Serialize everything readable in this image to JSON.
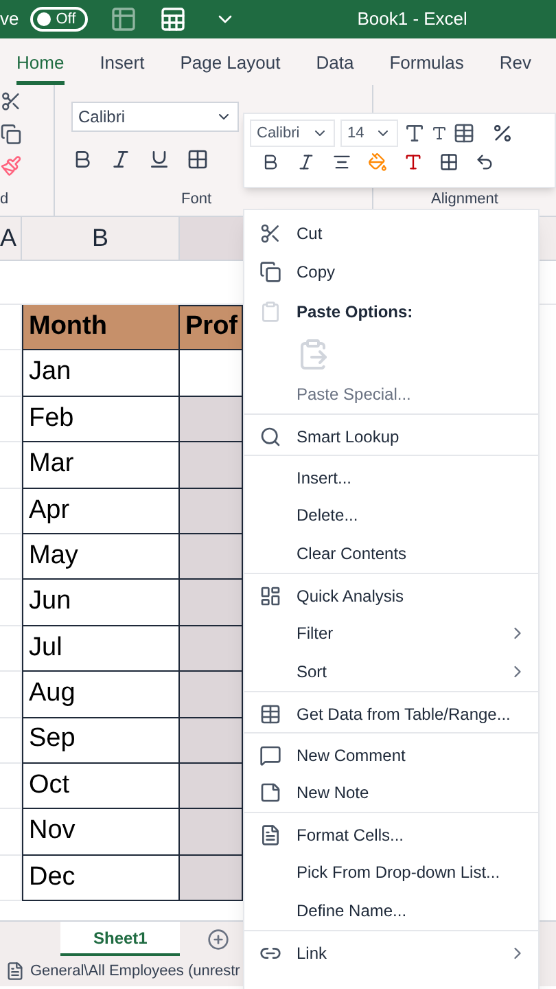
{
  "title_bar": {
    "autosave_label": "ve",
    "toggle": {
      "label": "Off",
      "on": false
    },
    "title": "Book1  -  Excel"
  },
  "ribbon_tabs": [
    {
      "label": "Home",
      "selected": true
    },
    {
      "label": "Insert",
      "selected": false
    },
    {
      "label": "Page Layout",
      "selected": false
    },
    {
      "label": "Data",
      "selected": false
    },
    {
      "label": "Formulas",
      "selected": false
    },
    {
      "label": "Rev",
      "selected": false
    }
  ],
  "ribbon": {
    "font_name": "Calibri",
    "groups": [
      "d",
      "Font",
      "Alignment"
    ]
  },
  "mini_toolbar": {
    "font_name": "Calibri",
    "font_size": "14"
  },
  "columns": [
    "A",
    "B"
  ],
  "sheet": {
    "rows": [
      {
        "kind": "header",
        "month": "Month",
        "c": "Prof"
      },
      {
        "kind": "data",
        "month": "Jan",
        "selected": false
      },
      {
        "kind": "data",
        "month": "Feb",
        "selected": true
      },
      {
        "kind": "data",
        "month": "Mar",
        "selected": true
      },
      {
        "kind": "data",
        "month": "Apr",
        "selected": true
      },
      {
        "kind": "data",
        "month": "May",
        "selected": true
      },
      {
        "kind": "data",
        "month": "Jun",
        "selected": true
      },
      {
        "kind": "data",
        "month": "Jul",
        "selected": true
      },
      {
        "kind": "data",
        "month": "Aug",
        "selected": true
      },
      {
        "kind": "data",
        "month": "Sep",
        "selected": true
      },
      {
        "kind": "data",
        "month": "Oct",
        "selected": true
      },
      {
        "kind": "data",
        "month": "Nov",
        "selected": true
      },
      {
        "kind": "data",
        "month": "Dec",
        "selected": true
      }
    ]
  },
  "context_menu": [
    {
      "kind": "item",
      "label": "Cut",
      "disabled": false,
      "submenu": false,
      "separator_above": false
    },
    {
      "kind": "item",
      "label": "Copy",
      "disabled": false,
      "submenu": false,
      "separator_above": false
    },
    {
      "kind": "heading",
      "label": "Paste Options:"
    },
    {
      "kind": "paste-icons",
      "disabled": true
    },
    {
      "kind": "item",
      "label": "Paste Special...",
      "disabled": true,
      "submenu": false,
      "separator_above": false
    },
    {
      "kind": "item",
      "label": "Smart Lookup",
      "disabled": false,
      "submenu": false,
      "separator_above": true
    },
    {
      "kind": "item",
      "label": "Insert...",
      "disabled": false,
      "submenu": false,
      "separator_above": true
    },
    {
      "kind": "item",
      "label": "Delete...",
      "disabled": false,
      "submenu": false,
      "separator_above": false
    },
    {
      "kind": "item",
      "label": "Clear Contents",
      "disabled": false,
      "submenu": false,
      "separator_above": false
    },
    {
      "kind": "item",
      "label": "Quick Analysis",
      "disabled": false,
      "submenu": false,
      "separator_above": true
    },
    {
      "kind": "item",
      "label": "Filter",
      "disabled": false,
      "submenu": true,
      "separator_above": false
    },
    {
      "kind": "item",
      "label": "Sort",
      "disabled": false,
      "submenu": true,
      "separator_above": false
    },
    {
      "kind": "item",
      "label": "Get Data from Table/Range...",
      "disabled": false,
      "submenu": false,
      "separator_above": true
    },
    {
      "kind": "item",
      "label": "New Comment",
      "disabled": false,
      "submenu": false,
      "separator_above": true
    },
    {
      "kind": "item",
      "label": "New Note",
      "disabled": false,
      "submenu": false,
      "separator_above": false
    },
    {
      "kind": "item",
      "label": "Format Cells...",
      "disabled": false,
      "submenu": false,
      "separator_above": true
    },
    {
      "kind": "item",
      "label": "Pick From Drop-down List...",
      "disabled": false,
      "submenu": false,
      "separator_above": false
    },
    {
      "kind": "item",
      "label": "Define Name...",
      "disabled": false,
      "submenu": false,
      "separator_above": false
    },
    {
      "kind": "item",
      "label": "Link",
      "disabled": false,
      "submenu": true,
      "separator_above": true
    }
  ],
  "sheet_tabs": [
    {
      "label": "Sheet1",
      "selected": true
    }
  ],
  "status_bar": {
    "text": "General\\All Employees (unrestr"
  }
}
